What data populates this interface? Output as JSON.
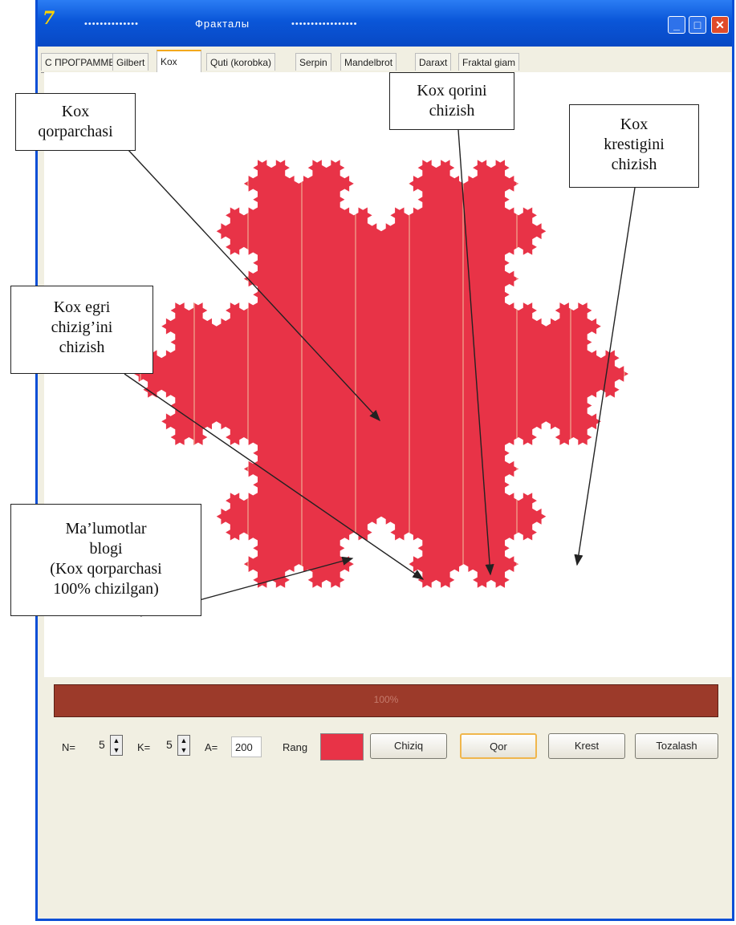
{
  "window": {
    "title_left": "••••••••••••••",
    "title": "Фракталы",
    "title_right": "•••••••••••••••••",
    "app_icon": "7"
  },
  "tabs": [
    {
      "label": "С ПРОГРАММЕ"
    },
    {
      "label": "Gilbert"
    },
    {
      "label": "Kox"
    },
    {
      "label": "Quti (korobka)"
    },
    {
      "label": "Serpin"
    },
    {
      "label": "Mandelbrot"
    },
    {
      "label": "Daraxt"
    },
    {
      "label": "Fraktal giam"
    }
  ],
  "active_tab": "Kox",
  "colors": {
    "fill": "#e83347",
    "stripe": "#f2c3a0",
    "progress": "#9a3b2b",
    "accent": "#f3a81c"
  },
  "annotations": [
    {
      "id": "qorparchasi",
      "text": "Kox\nqorparchasi"
    },
    {
      "id": "qorini",
      "text": "Kox qorini\nchizish"
    },
    {
      "id": "krestigini",
      "text": "Kox\nkrestigini\nchizish"
    },
    {
      "id": "egri",
      "text": "Kox egri\nchizig’ini\nchizish"
    },
    {
      "id": "malumotlar",
      "text": "Ma’lumotlar\nblogi\n(Kox qorparchasi\n100% chizilgan)"
    }
  ],
  "progress": {
    "value": 1.0,
    "text": "100%"
  },
  "controls": {
    "n_label": "N=",
    "n_value": "5",
    "k_label": "K=",
    "k_value": "5",
    "a_label": "A=",
    "a_value": "200",
    "color_label": "Rang",
    "buttons": {
      "line": "Chiziq",
      "snowflake": "Qor",
      "cross": "Krest",
      "clear": "Tozalash"
    }
  }
}
